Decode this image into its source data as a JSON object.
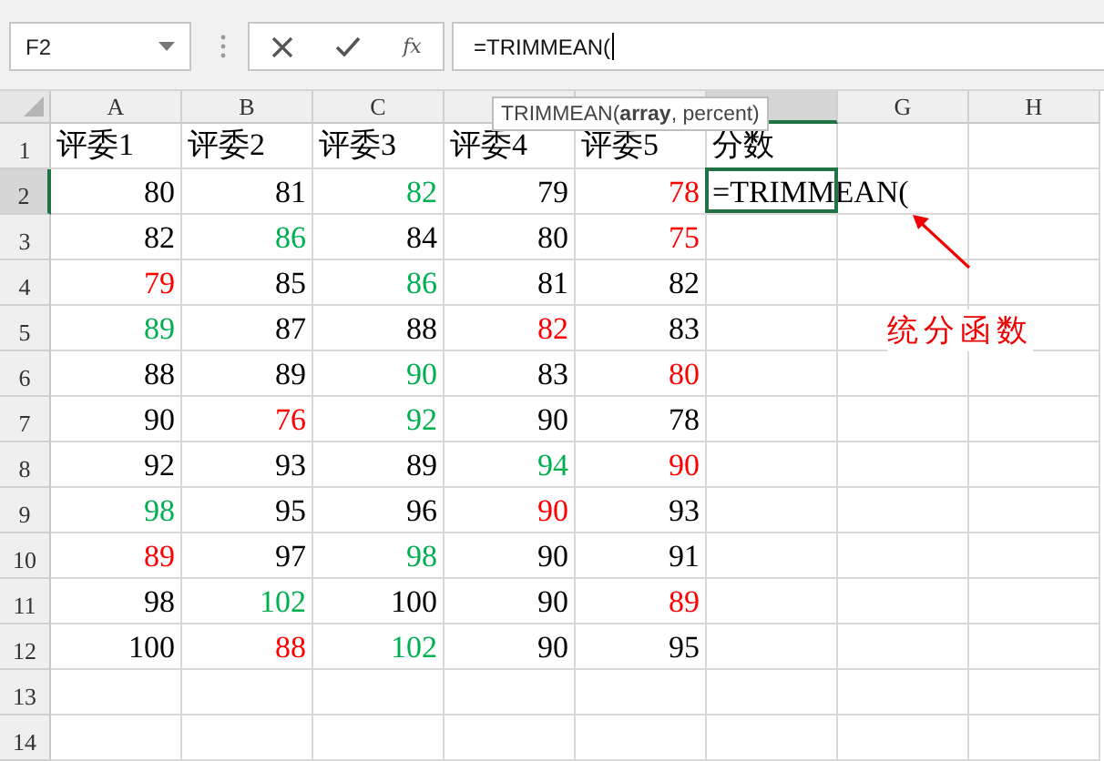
{
  "name_box": {
    "value": "F2"
  },
  "formula_bar": {
    "function_label": "fx",
    "value": "=TRIMMEAN("
  },
  "tooltip": "TRIMMEAN(**array**, percent)",
  "columns": [
    {
      "label": "A",
      "selected": false
    },
    {
      "label": "B",
      "selected": false
    },
    {
      "label": "C",
      "selected": false
    },
    {
      "selected": false
    },
    {
      "selected": false
    },
    {
      "selected": true
    },
    {
      "label": "G",
      "selected": false
    },
    {
      "label": "H",
      "selected": false
    }
  ],
  "rows": [
    {
      "label": "1",
      "selected": false,
      "cells": [
        {
          "text": "评委1",
          "color": "#000000"
        },
        {
          "text": "评委2",
          "color": "#000000"
        },
        {
          "text": "评委3",
          "color": "#000000"
        },
        {
          "text": "评委4",
          "color": "#000000"
        },
        {
          "text": "评委5",
          "color": "#000000"
        },
        {
          "text": "分数",
          "color": "#000000"
        }
      ]
    },
    {
      "label": "2",
      "selected": true,
      "cells": [
        {
          "text": "80",
          "color": "#000000"
        },
        {
          "text": "81",
          "color": "#000000"
        },
        {
          "text": "82",
          "color": "#00b050"
        },
        {
          "text": "79",
          "color": "#000000"
        },
        {
          "text": "78",
          "color": "#ff0000"
        },
        {
          "text": "=TRIMMEAN(",
          "color": "#000000"
        }
      ]
    },
    {
      "label": "3",
      "selected": false,
      "cells": [
        {
          "text": "82",
          "color": "#000000"
        },
        {
          "text": "86",
          "color": "#00b050"
        },
        {
          "text": "84",
          "color": "#000000"
        },
        {
          "text": "80",
          "color": "#000000"
        },
        {
          "text": "75",
          "color": "#ff0000"
        }
      ]
    },
    {
      "label": "4",
      "selected": false,
      "cells": [
        {
          "text": "79",
          "color": "#ff0000"
        },
        {
          "text": "85",
          "color": "#000000"
        },
        {
          "text": "86",
          "color": "#00b050"
        },
        {
          "text": "81",
          "color": "#000000"
        },
        {
          "text": "82",
          "color": "#000000"
        }
      ]
    },
    {
      "label": "5",
      "selected": false,
      "cells": [
        {
          "text": "89",
          "color": "#00b050"
        },
        {
          "text": "87",
          "color": "#000000"
        },
        {
          "text": "88",
          "color": "#000000"
        },
        {
          "text": "82",
          "color": "#ff0000"
        },
        {
          "text": "83",
          "color": "#000000"
        }
      ]
    },
    {
      "label": "6",
      "selected": false,
      "cells": [
        {
          "text": "88",
          "color": "#000000"
        },
        {
          "text": "89",
          "color": "#000000"
        },
        {
          "text": "90",
          "color": "#00b050"
        },
        {
          "text": "83",
          "color": "#000000"
        },
        {
          "text": "80",
          "color": "#ff0000"
        }
      ]
    },
    {
      "label": "7",
      "selected": false,
      "cells": [
        {
          "text": "90",
          "color": "#000000"
        },
        {
          "text": "76",
          "color": "#ff0000"
        },
        {
          "text": "92",
          "color": "#00b050"
        },
        {
          "text": "90",
          "color": "#000000"
        },
        {
          "text": "78",
          "color": "#000000"
        }
      ]
    },
    {
      "label": "8",
      "selected": false,
      "cells": [
        {
          "text": "92",
          "color": "#000000"
        },
        {
          "text": "93",
          "color": "#000000"
        },
        {
          "text": "89",
          "color": "#000000"
        },
        {
          "text": "94",
          "color": "#00b050"
        },
        {
          "text": "90",
          "color": "#ff0000"
        }
      ]
    },
    {
      "label": "9",
      "selected": false,
      "cells": [
        {
          "text": "98",
          "color": "#00b050"
        },
        {
          "text": "95",
          "color": "#000000"
        },
        {
          "text": "96",
          "color": "#000000"
        },
        {
          "text": "90",
          "color": "#ff0000"
        },
        {
          "text": "93",
          "color": "#000000"
        }
      ]
    },
    {
      "label": "10",
      "selected": false,
      "cells": [
        {
          "text": "89",
          "color": "#ff0000"
        },
        {
          "text": "97",
          "color": "#000000"
        },
        {
          "text": "98",
          "color": "#00b050"
        },
        {
          "text": "90",
          "color": "#000000"
        },
        {
          "text": "91",
          "color": "#000000"
        }
      ]
    },
    {
      "label": "11",
      "selected": false,
      "cells": [
        {
          "text": "98",
          "color": "#000000"
        },
        {
          "text": "102",
          "color": "#00b050"
        },
        {
          "text": "100",
          "color": "#000000"
        },
        {
          "text": "90",
          "color": "#000000"
        },
        {
          "text": "89",
          "color": "#ff0000"
        }
      ]
    },
    {
      "label": "12",
      "selected": false,
      "cells": [
        {
          "text": "100",
          "color": "#000000"
        },
        {
          "text": "88",
          "color": "#ff0000"
        },
        {
          "text": "102",
          "color": "#00b050"
        },
        {
          "text": "90",
          "color": "#000000"
        },
        {
          "text": "95",
          "color": "#000000"
        }
      ]
    },
    {
      "label": "13",
      "selected": false,
      "cells": []
    },
    {
      "label": "14",
      "selected": false,
      "cells": []
    }
  ],
  "annotation": "统分函数"
}
